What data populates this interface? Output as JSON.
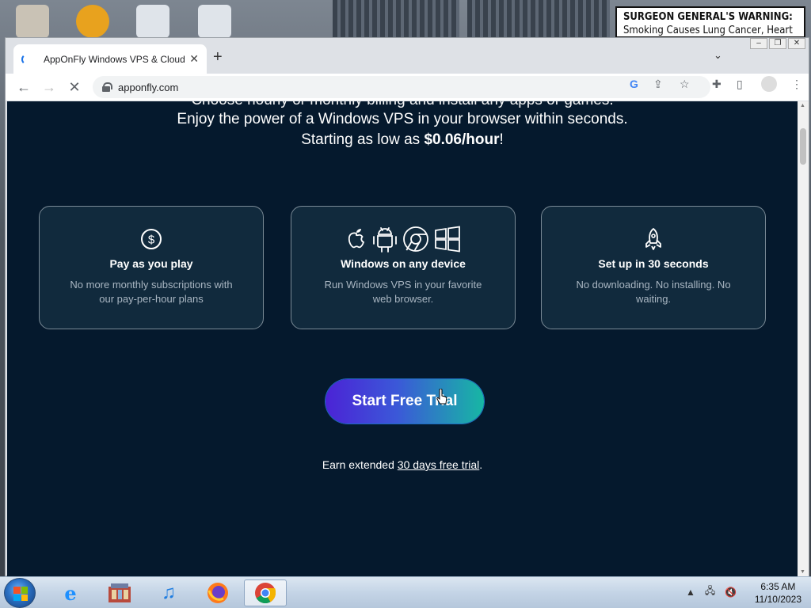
{
  "desktop": {
    "warning_title": "SURGEON GENERAL'S WARNING:",
    "warning_text": "Smoking Causes Lung Cancer, Heart Disease,"
  },
  "browser": {
    "tab_title": "AppOnFly Windows VPS & Cloud",
    "url": "apponfly.com"
  },
  "page": {
    "intro_line1": "Choose hourly or monthly billing and install any apps or games.",
    "intro_line2": "Enjoy the power of a Windows VPS in your browser within seconds.",
    "intro_line3_prefix": "Starting as low as ",
    "intro_price": "$0.06/hour",
    "intro_line3_suffix": "!",
    "features": [
      {
        "icon": "dollar-circle-icon",
        "title": "Pay as you play",
        "description": "No more monthly subscriptions with our pay-per-hour plans"
      },
      {
        "icon": "platform-icons",
        "title": "Windows on any device",
        "description": "Run Windows VPS in your favorite web browser."
      },
      {
        "icon": "rocket-icon",
        "title": "Set up in 30 seconds",
        "description": "No downloading. No installing. No waiting."
      }
    ],
    "cta_label": "Start Free Trial",
    "earn_prefix": "Earn extended ",
    "earn_link": "30 days free trial",
    "earn_suffix": "."
  },
  "taskbar": {
    "clock_time": "6:35 AM",
    "clock_date": "11/10/2023"
  },
  "colors": {
    "page_bg": "#05192d",
    "card_bg": "#112a3d",
    "cta_start": "#4b23d6",
    "cta_end": "#17b7a4"
  }
}
